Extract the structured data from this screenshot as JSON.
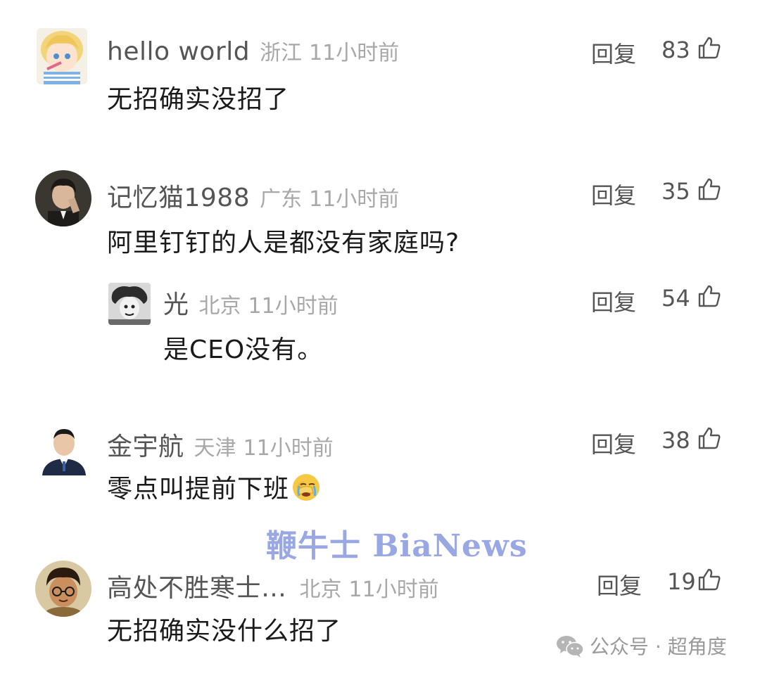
{
  "comments": [
    {
      "username": "hello world",
      "location": "浙江",
      "time": "11小时前",
      "text": "无招确实没招了",
      "reply_label": "回复",
      "likes": "83"
    },
    {
      "username": "记忆猫1988",
      "location": "广东",
      "time": "11小时前",
      "text": "阿里钉钉的人是都没有家庭吗?",
      "reply_label": "回复",
      "likes": "35"
    },
    {
      "username": "光",
      "location": "北京",
      "time": "11小时前",
      "text": "是CEO没有。",
      "reply_label": "回复",
      "likes": "54",
      "is_reply": true
    },
    {
      "username": "金宇航",
      "location": "天津",
      "time": "11小时前",
      "text": "零点叫提前下班",
      "reply_label": "回复",
      "likes": "38",
      "emoji": "face-palm-crying-emoji"
    },
    {
      "username": "高处不胜寒士…",
      "location": "北京",
      "time": "11小时前",
      "text": "无招确实没什么招了",
      "reply_label": "回复",
      "likes": "19"
    }
  ],
  "watermark": "鞭牛士 BiaNews",
  "source": {
    "label": "公众号 · 超角度",
    "icon": "wechat-icon"
  },
  "colors": {
    "username": "#555555",
    "meta": "#a8a8a8",
    "text": "#1a1a1a",
    "watermark": "#8f9fe0"
  }
}
